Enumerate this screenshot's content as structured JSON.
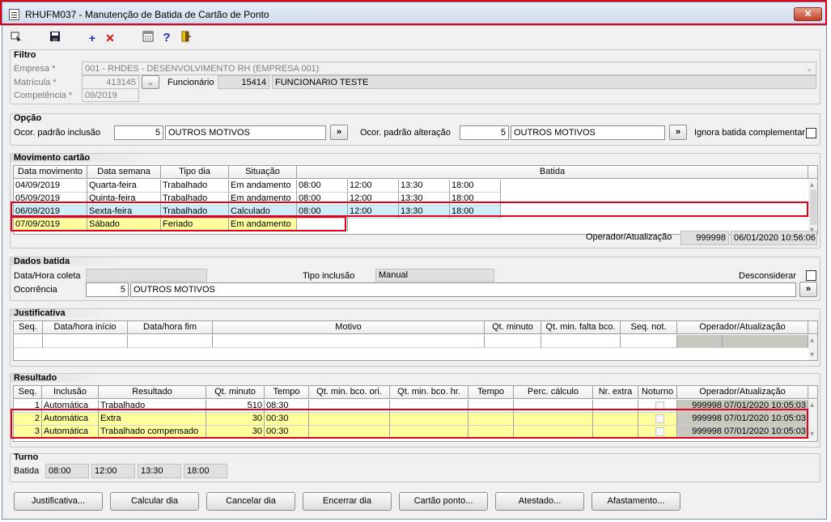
{
  "window": {
    "title": "RHUFM037 - Manutenção de Batida de Cartão de Ponto",
    "close_label": "✕"
  },
  "toolbar": {
    "icons": [
      "select-icon",
      "save-icon",
      "add-icon",
      "delete-icon",
      "calculator-icon",
      "help-icon",
      "exit-icon"
    ]
  },
  "filtro": {
    "title": "Filtro",
    "empresa_label": "Empresa *",
    "empresa_value": "001 - RHDES - DESENVOLVIMENTO RH (EMPRESA 001)",
    "matricula_label": "Matrícula *",
    "matricula_value": "413145",
    "funcionario_label": "Funcionário",
    "funcionario_code": "15414",
    "funcionario_name": "FUNCIONARIO TESTE",
    "competencia_label": "Competência *",
    "competencia_value": "09/2019"
  },
  "opcao": {
    "title": "Opção",
    "inclusao_label": "Ocor. padrão inclusão",
    "inclusao_code": "5",
    "inclusao_desc": "OUTROS MOTIVOS",
    "alteracao_label": "Ocor. padrão alteração",
    "alteracao_code": "5",
    "alteracao_desc": "OUTROS MOTIVOS",
    "ignora_label": "Ignora batida complementar",
    "lookup_label": "»"
  },
  "movimento": {
    "title": "Movimento cartão",
    "columns": [
      "Data movimento",
      "Data semana",
      "Tipo dia",
      "Situação",
      "Batida"
    ],
    "rows": [
      {
        "data": "04/09/2019",
        "semana": "Quarta-feira",
        "tipo": "Trabalhado",
        "situacao": "Em andamento",
        "batidas": [
          "08:00",
          "12:00",
          "13:30",
          "18:00"
        ]
      },
      {
        "data": "05/09/2019",
        "semana": "Quinta-feira",
        "tipo": "Trabalhado",
        "situacao": "Em andamento",
        "batidas": [
          "08:00",
          "12:00",
          "13:30",
          "18:00"
        ]
      },
      {
        "data": "06/09/2019",
        "semana": "Sexta-feira",
        "tipo": "Trabalhado",
        "situacao": "Calculado",
        "batidas": [
          "08:00",
          "12:00",
          "13:30",
          "18:00"
        ]
      },
      {
        "data": "07/09/2019",
        "semana": "Sábado",
        "tipo": "Feriado",
        "situacao": "Em andamento",
        "batidas": [
          "",
          "",
          "",
          ""
        ]
      }
    ],
    "operador_label": "Operador/Atualização",
    "operador_code": "999998",
    "operador_date": "06/01/2020 10:56:06"
  },
  "dados": {
    "title": "Dados batida",
    "coleta_label": "Data/Hora coleta",
    "coleta_value": "",
    "tipo_label": "Tipo inclusão",
    "tipo_value": "Manual",
    "desconsiderar_label": "Desconsiderar",
    "ocorrencia_label": "Ocorrência",
    "ocorrencia_code": "5",
    "ocorrencia_desc": "OUTROS MOTIVOS"
  },
  "justificativa": {
    "title": "Justificativa",
    "columns": [
      "Seq.",
      "Data/hora início",
      "Data/hora fim",
      "Motivo",
      "Qt. minuto",
      "Qt. min. falta bco.",
      "Seq. not.",
      "Operador/Atualização"
    ]
  },
  "resultado": {
    "title": "Resultado",
    "columns": [
      "Seq.",
      "Inclusão",
      "Resultado",
      "Qt. minuto",
      "Tempo",
      "Qt. min. bco. ori.",
      "Qt. min. bco. hr.",
      "Tempo",
      "Perc. cálculo",
      "Nr. extra",
      "Noturno",
      "Operador/Atualização"
    ],
    "rows": [
      {
        "seq": "1",
        "inclusao": "Automática",
        "resultado": "Trabalhado",
        "qt": "510",
        "tempo": "08:30",
        "operador": "999998 07/01/2020 10:05:03"
      },
      {
        "seq": "2",
        "inclusao": "Automática",
        "resultado": "Extra",
        "qt": "30",
        "tempo": "00:30",
        "operador": "999998 07/01/2020 10:05:03"
      },
      {
        "seq": "3",
        "inclusao": "Automática",
        "resultado": "Trabalhado compensado",
        "qt": "30",
        "tempo": "00:30",
        "operador": "999998 07/01/2020 10:05:03"
      }
    ]
  },
  "turno": {
    "title": "Turno",
    "batida_label": "Batida",
    "batidas": [
      "08:00",
      "12:00",
      "13:30",
      "18:00"
    ]
  },
  "buttons": [
    "Justificativa...",
    "Calcular dia",
    "Cancelar dia",
    "Encerrar dia",
    "Cartão ponto...",
    "Atestado...",
    "Afastamento..."
  ],
  "colors": {
    "highlight_red": "#e0001a",
    "selected_row": "#cfeefb",
    "result_yellow": "#ffff9e"
  }
}
